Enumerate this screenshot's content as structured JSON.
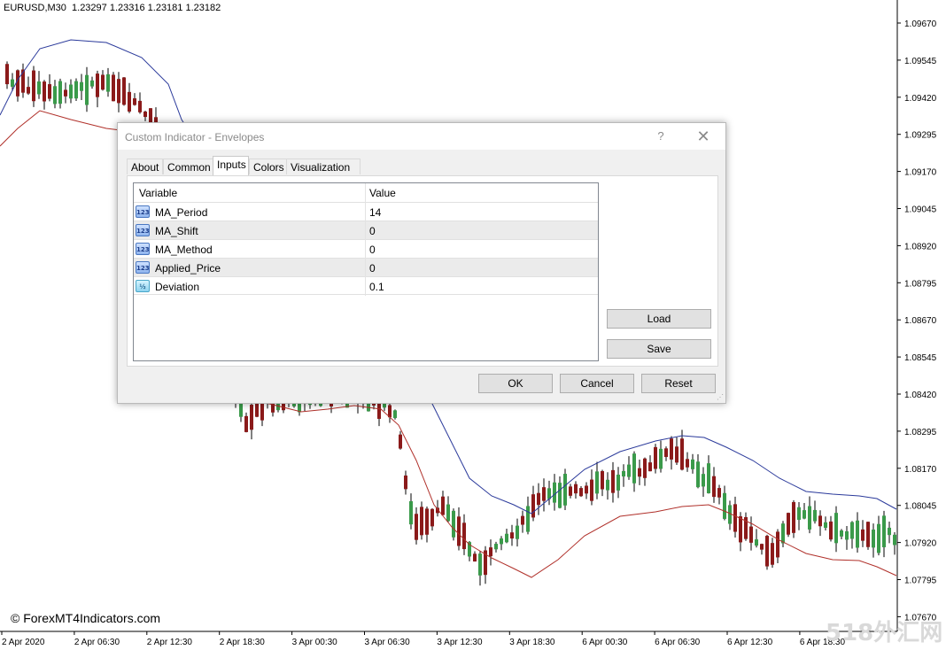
{
  "chart": {
    "symbol_label": "EURUSD,M30  1.23297 1.23316 1.23181 1.23182",
    "copyright": "© ForexMT4Indicators.com",
    "watermark": "518外汇网",
    "price_ticks": [
      "1.09670",
      "1.09545",
      "1.09420",
      "1.09295",
      "1.09170",
      "1.09045",
      "1.08920",
      "1.08795",
      "1.08670",
      "1.08545",
      "1.08420",
      "1.08295",
      "1.08170",
      "1.08045",
      "1.07920",
      "1.07795",
      "1.07670"
    ],
    "time_ticks": [
      "2 Apr 2020",
      "2 Apr 06:30",
      "2 Apr 12:30",
      "2 Apr 18:30",
      "3 Apr 00:30",
      "3 Apr 06:30",
      "3 Apr 12:30",
      "3 Apr 18:30",
      "6 Apr 00:30",
      "6 Apr 06:30",
      "6 Apr 12:30",
      "6 Apr 18:30"
    ],
    "colors": {
      "bull": "#3a9a4a",
      "bear": "#8b1a1a",
      "upper_band": "#2b3a9b",
      "lower_band": "#b0302a",
      "axis": "#000000"
    }
  },
  "dialog": {
    "title": "Custom Indicator - Envelopes",
    "help_icon": "?",
    "close_icon": "✕",
    "tabs": [
      {
        "label": "About",
        "active": false
      },
      {
        "label": "Common",
        "active": false
      },
      {
        "label": "Inputs",
        "active": true
      },
      {
        "label": "Colors",
        "active": false
      },
      {
        "label": "Visualization",
        "active": false
      }
    ],
    "grid": {
      "headers": [
        "Variable",
        "Value"
      ],
      "rows": [
        {
          "icon": "123",
          "name": "MA_Period",
          "value": "14"
        },
        {
          "icon": "123",
          "name": "MA_Shift",
          "value": "0"
        },
        {
          "icon": "123",
          "name": "MA_Method",
          "value": "0"
        },
        {
          "icon": "123",
          "name": "Applied_Price",
          "value": "0"
        },
        {
          "icon": "½",
          "name": "Deviation",
          "value": "0.1"
        }
      ]
    },
    "buttons": {
      "load": "Load",
      "save": "Save",
      "ok": "OK",
      "cancel": "Cancel",
      "reset": "Reset"
    }
  }
}
